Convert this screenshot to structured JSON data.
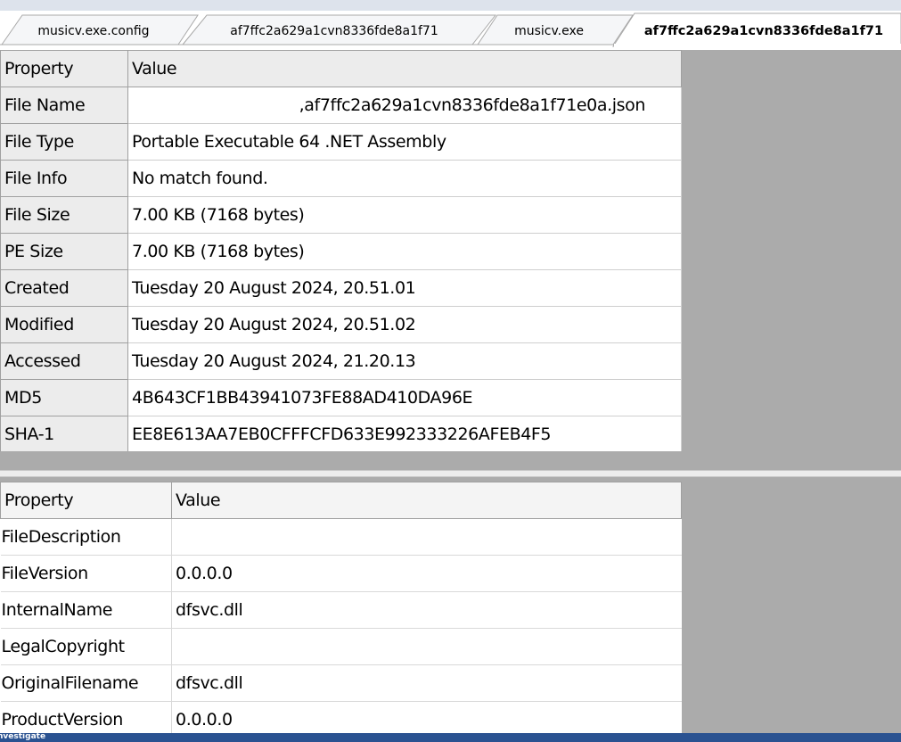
{
  "tabs": [
    {
      "label": "musicv.exe.config",
      "active": false
    },
    {
      "label": "af7ffc2a629a1cvn8336fde8a1f71",
      "active": false
    },
    {
      "label": "musicv.exe",
      "active": false
    },
    {
      "label": "af7ffc2a629a1cvn8336fde8a1f71",
      "active": true
    }
  ],
  "file_properties": {
    "header": {
      "property": "Property",
      "value": "Value"
    },
    "rows": [
      {
        "property": "File Name",
        "value": ",af7ffc2a629a1cvn8336fde8a1f71e0a.json"
      },
      {
        "property": "File Type",
        "value": "Portable Executable 64 .NET Assembly"
      },
      {
        "property": "File Info",
        "value": "No match found."
      },
      {
        "property": "File Size",
        "value": "7.00 KB (7168 bytes)"
      },
      {
        "property": "PE Size",
        "value": "7.00 KB (7168 bytes)"
      },
      {
        "property": "Created",
        "value": "Tuesday 20 August 2024, 20.51.01"
      },
      {
        "property": "Modified",
        "value": "Tuesday 20 August 2024, 20.51.02"
      },
      {
        "property": "Accessed",
        "value": "Tuesday 20 August 2024, 21.20.13"
      },
      {
        "property": "MD5",
        "value": "4B643CF1BB43941073FE88AD410DA96E"
      },
      {
        "property": "SHA-1",
        "value": "EE8E613AA7EB0CFFFCFD633E992333226AFEB4F5"
      }
    ]
  },
  "version_info": {
    "header": {
      "property": "Property",
      "value": "Value"
    },
    "rows": [
      {
        "property": "FileDescription",
        "value": ""
      },
      {
        "property": "FileVersion",
        "value": "0.0.0.0"
      },
      {
        "property": "InternalName",
        "value": "dfsvc.dll"
      },
      {
        "property": "LegalCopyright",
        "value": ""
      },
      {
        "property": "OriginalFilename",
        "value": "dfsvc.dll"
      },
      {
        "property": "ProductVersion",
        "value": "0.0.0.0"
      }
    ]
  },
  "statusbar": {
    "text": "nvestigate"
  },
  "colors": {
    "tab_band": "#dde3ec",
    "pane_background": "#ababab",
    "header_background": "#ececec",
    "statusbar": "#2a5291"
  }
}
